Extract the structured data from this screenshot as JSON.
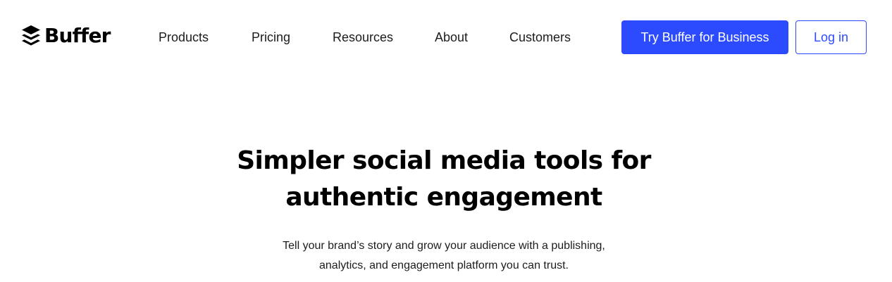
{
  "brand": {
    "name": "Buffer",
    "logo_icon": "buffer-stack-icon"
  },
  "nav": {
    "items": [
      {
        "label": "Products"
      },
      {
        "label": "Pricing"
      },
      {
        "label": "Resources"
      },
      {
        "label": "About"
      },
      {
        "label": "Customers"
      }
    ]
  },
  "header_actions": {
    "primary_label": "Try Buffer for Business",
    "secondary_label": "Log in"
  },
  "hero": {
    "title_line1": "Simpler social media tools for",
    "title_line2": "authentic engagement",
    "subtitle_line1": "Tell your brand’s story and grow your audience with a publishing,",
    "subtitle_line2": "analytics, and engagement platform you can trust."
  },
  "colors": {
    "accent": "#2c4bff",
    "text": "#000000",
    "body_text": "#1c1c1c",
    "background": "#ffffff"
  }
}
